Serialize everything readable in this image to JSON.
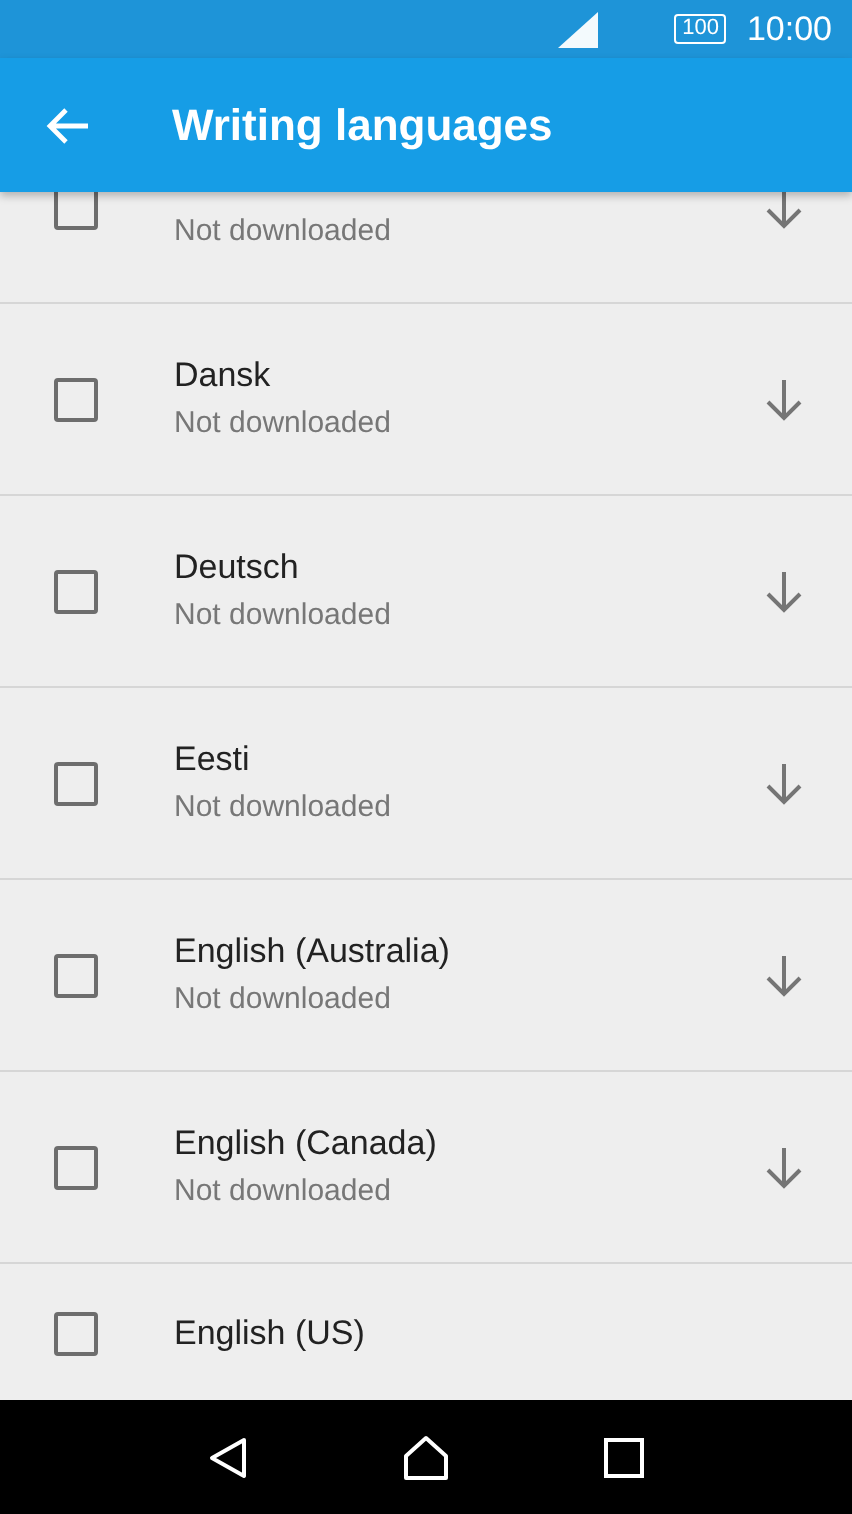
{
  "status_bar": {
    "time": "10:00",
    "battery": "100"
  },
  "app_bar": {
    "title": "Writing languages"
  },
  "languages": [
    {
      "status": "Not downloaded",
      "checked": false,
      "downloadable": true
    },
    {
      "title": "Dansk",
      "status": "Not downloaded",
      "checked": false,
      "downloadable": true
    },
    {
      "title": "Deutsch",
      "status": "Not downloaded",
      "checked": false,
      "downloadable": true
    },
    {
      "title": "Eesti",
      "status": "Not downloaded",
      "checked": false,
      "downloadable": true
    },
    {
      "title": "English (Australia)",
      "status": "Not downloaded",
      "checked": false,
      "downloadable": true
    },
    {
      "title": "English (Canada)",
      "status": "Not downloaded",
      "checked": false,
      "downloadable": true
    },
    {
      "title": "English (US)",
      "checked": false,
      "downloadable": false
    }
  ]
}
